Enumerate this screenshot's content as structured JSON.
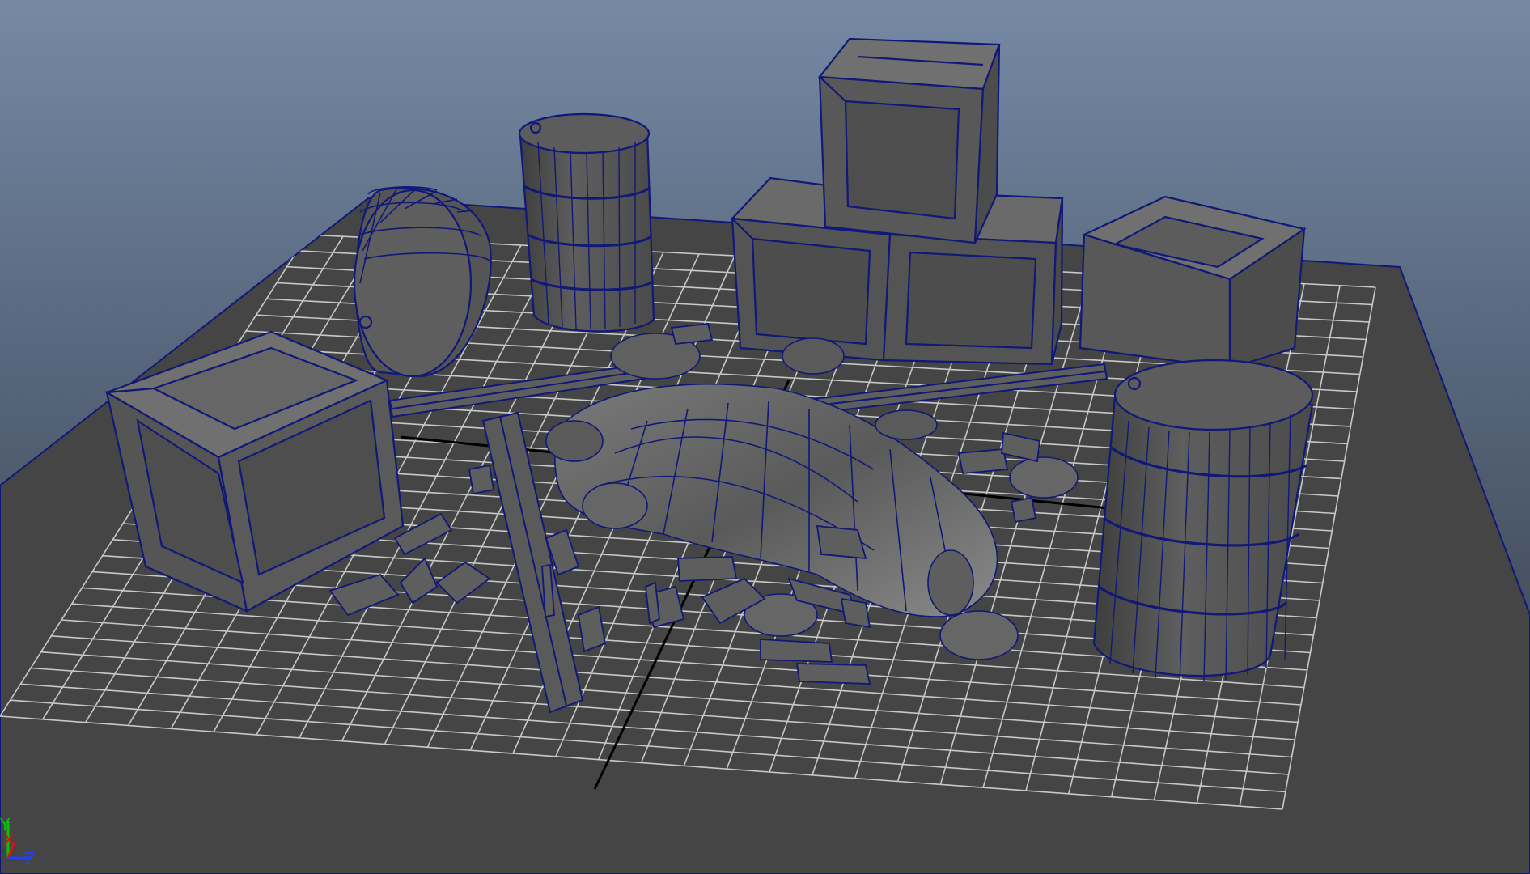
{
  "viewport": {
    "background_top": "#7387a3",
    "background_bottom": "#3d4552",
    "ground_color": "#454545",
    "grid_color": "#c8c8c8",
    "wire_color": "#101878",
    "object_fill": "#6e6e6e",
    "object_fill_dark": "#505050",
    "axis_line_color": "#000000"
  },
  "axis_gizmo": {
    "y_label": "Y",
    "x_label": "X",
    "z_label": "Z",
    "y_color": "#00c800",
    "x_color": "#e01010",
    "z_color": "#2040ff"
  },
  "scene": {
    "objects": [
      {
        "name": "crate-front-left",
        "kind": "crate"
      },
      {
        "name": "barrel-lying-left",
        "kind": "barrel"
      },
      {
        "name": "barrel-standing-back",
        "kind": "barrel"
      },
      {
        "name": "crate-stack-bottom-left",
        "kind": "crate"
      },
      {
        "name": "crate-stack-bottom-right",
        "kind": "crate"
      },
      {
        "name": "crate-stack-top",
        "kind": "crate"
      },
      {
        "name": "crate-right",
        "kind": "crate"
      },
      {
        "name": "barrel-standing-right",
        "kind": "barrel"
      },
      {
        "name": "wrecked-vehicle",
        "kind": "mesh"
      },
      {
        "name": "plank-left",
        "kind": "plank"
      },
      {
        "name": "plank-right",
        "kind": "plank"
      },
      {
        "name": "plank-upright",
        "kind": "plank"
      },
      {
        "name": "debris-bricks",
        "kind": "debris"
      }
    ]
  }
}
